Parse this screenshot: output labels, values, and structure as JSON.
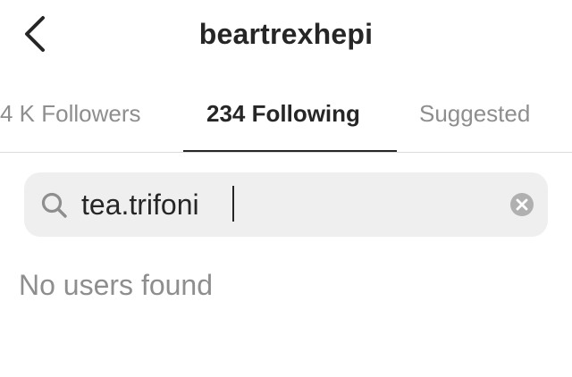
{
  "header": {
    "back_icon": "chevron-left-icon",
    "username": "beartrexhepi"
  },
  "tabs": [
    {
      "label": "4 K Followers",
      "active": false
    },
    {
      "label": "234 Following",
      "active": true
    },
    {
      "label": "Suggested",
      "active": false
    }
  ],
  "search": {
    "icon": "search-icon",
    "value": "tea.trifoni",
    "clear_icon": "clear-circle-icon"
  },
  "results": {
    "empty_message": "No users found"
  },
  "colors": {
    "primary_text": "#262626",
    "secondary_text": "#8e8e8e",
    "search_background": "#efefef",
    "divider": "#dbdbdb"
  }
}
